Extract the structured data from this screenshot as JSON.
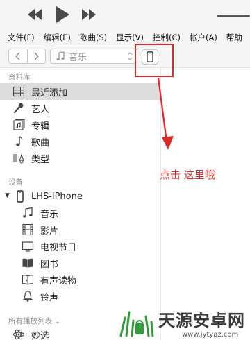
{
  "menu": [
    "文件(F)",
    "编辑(E)",
    "歌曲(S)",
    "显示(V)",
    "控制(C)",
    "帐户(A)",
    "帮助"
  ],
  "toolbar": {
    "media_label": "音乐",
    "media_icon": "music-note-icon",
    "device_icon": "iphone-icon"
  },
  "sidebar": {
    "library_title": "资料库",
    "library_items": [
      {
        "label": "最近添加",
        "icon": "grid-icon",
        "selected": true
      },
      {
        "label": "艺人",
        "icon": "microphone-icon",
        "selected": false
      },
      {
        "label": "专辑",
        "icon": "album-icon",
        "selected": false
      },
      {
        "label": "歌曲",
        "icon": "music-note-icon",
        "selected": false
      },
      {
        "label": "类型",
        "icon": "genre-icon",
        "selected": false
      }
    ],
    "devices_title": "设备",
    "device_name": "LHS-iPhone",
    "device_items": [
      {
        "label": "音乐",
        "icon": "music-note-icon"
      },
      {
        "label": "影片",
        "icon": "film-icon"
      },
      {
        "label": "电视节目",
        "icon": "tv-icon"
      },
      {
        "label": "图书",
        "icon": "book-icon"
      },
      {
        "label": "有声读物",
        "icon": "audiobook-icon"
      },
      {
        "label": "铃声",
        "icon": "bell-icon"
      }
    ],
    "playlists_title": "所有播放列表 ⌄",
    "playlist_items": [
      {
        "label": "妙选",
        "icon": "genius-icon"
      }
    ]
  },
  "annotation": {
    "text": "点击 这里哦",
    "color": "#e02828"
  },
  "watermark": {
    "name": "天源安卓网",
    "url": "www.jytyaz.com"
  }
}
